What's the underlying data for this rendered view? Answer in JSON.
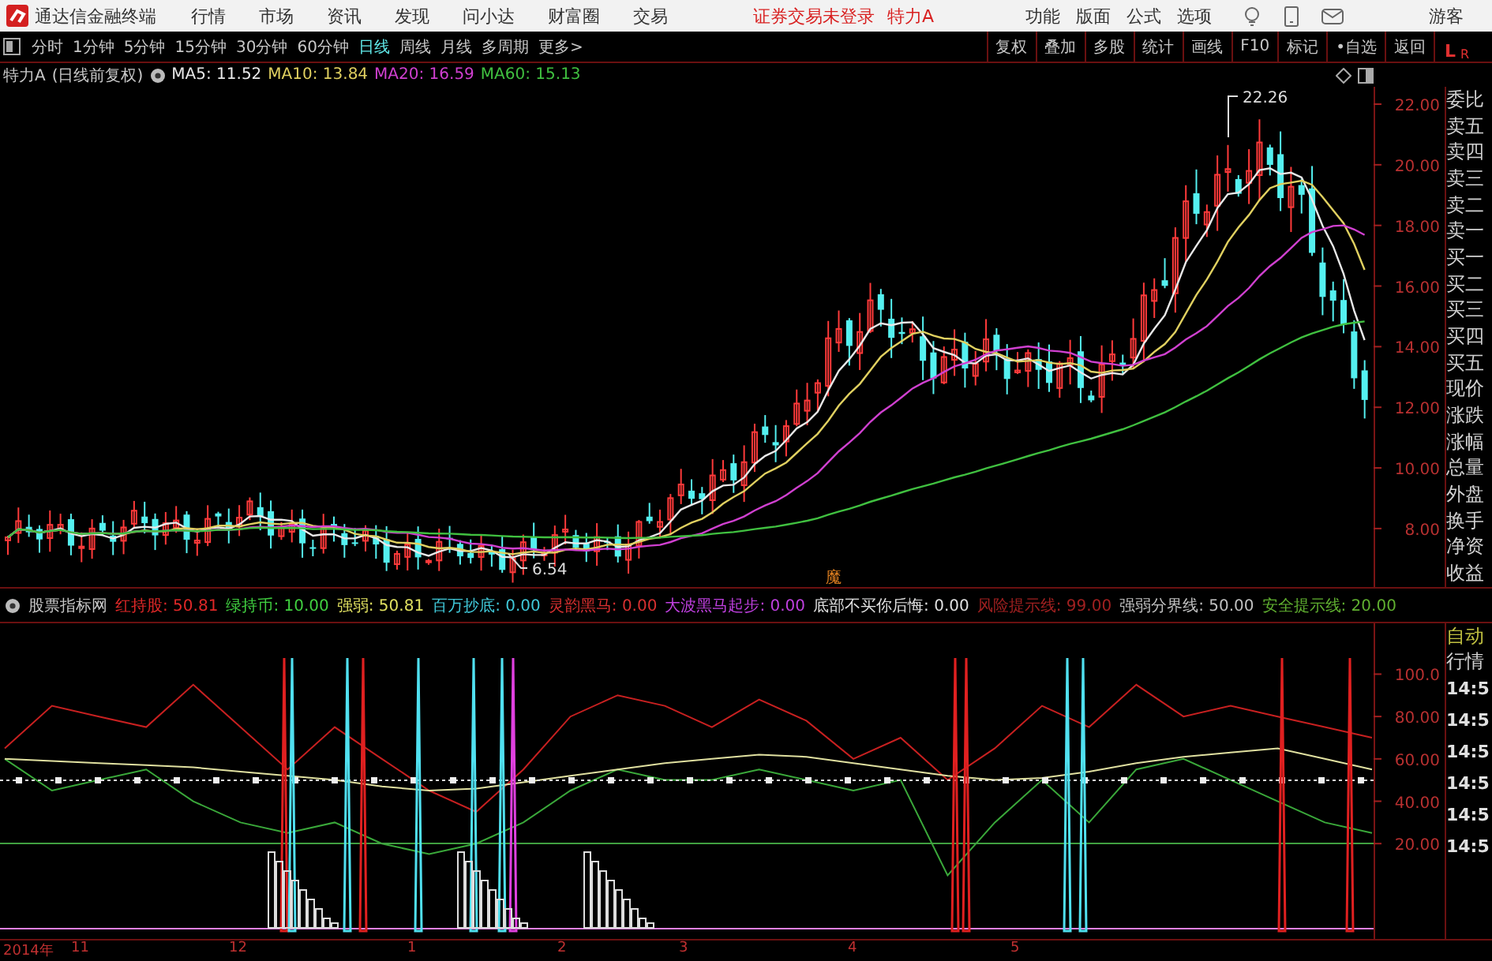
{
  "title_bar": {
    "app_name": "通达信金融终端",
    "menu": [
      "行情",
      "市场",
      "资讯",
      "发现",
      "问小达",
      "财富圈",
      "交易"
    ],
    "login_status": "证券交易未登录",
    "stock_name": "特力A",
    "right_menu": [
      "功能",
      "版面",
      "公式",
      "选项"
    ],
    "user": "游客"
  },
  "period_tabs": [
    {
      "label": "分时",
      "selected": false
    },
    {
      "label": "1分钟",
      "selected": false
    },
    {
      "label": "5分钟",
      "selected": false
    },
    {
      "label": "15分钟",
      "selected": false
    },
    {
      "label": "30分钟",
      "selected": false
    },
    {
      "label": "60分钟",
      "selected": false
    },
    {
      "label": "日线",
      "selected": true
    },
    {
      "label": "周线",
      "selected": false
    },
    {
      "label": "月线",
      "selected": false
    },
    {
      "label": "多周期",
      "selected": false
    },
    {
      "label": "更多>",
      "selected": false
    }
  ],
  "tool_buttons": [
    "复权",
    "叠加",
    "多股",
    "统计",
    "画线",
    "F10",
    "标记",
    "•自选",
    "返回"
  ],
  "corner_labels": [
    "L",
    "R"
  ],
  "price_chart": {
    "stock": "特力A",
    "mode": "(日线前复权)",
    "ma": [
      {
        "label": "MA5: 11.52",
        "color": "#e8e8e8"
      },
      {
        "label": "MA10: 13.84",
        "color": "#e0d060"
      },
      {
        "label": "MA20: 16.59",
        "color": "#d040d0"
      },
      {
        "label": "MA60: 15.13",
        "color": "#40c040"
      }
    ],
    "y_labels": [
      "22.00",
      "20.00",
      "18.00",
      "16.00",
      "14.00",
      "12.00",
      "10.00",
      "8.00"
    ],
    "high_label": "22.26",
    "low_label": "6.54",
    "marker": "魔"
  },
  "quote_fields": [
    "委比",
    "卖五",
    "卖四",
    "卖三",
    "卖二",
    "卖一",
    "买一",
    "买二",
    "买三",
    "买四",
    "买五",
    "现价",
    "涨跌",
    "涨幅",
    "总量",
    "外盘",
    "换手",
    "净资",
    "收益"
  ],
  "indicator": {
    "name": "股票指标网",
    "lines": [
      {
        "label": "红持股: 50.81",
        "color": "#e02828"
      },
      {
        "label": "绿持币: 10.00",
        "color": "#40d040"
      },
      {
        "label": "强弱: 50.81",
        "color": "#e0e060"
      },
      {
        "label": "百万抄底: 0.00",
        "color": "#40c8d8"
      },
      {
        "label": "灵韵黑马: 0.00",
        "color": "#d83030"
      },
      {
        "label": "大波黑马起步: 0.00",
        "color": "#c040e0"
      },
      {
        "label": "底部不买你后悔: 0.00",
        "color": "#e0e0e0"
      },
      {
        "label": "风险提示线: 99.00",
        "color": "#a02020"
      },
      {
        "label": "强弱分界线: 50.00",
        "color": "#c0c0c0"
      },
      {
        "label": "安全提示线: 20.00",
        "color": "#60b030"
      }
    ],
    "chart_data": {
      "type": "line",
      "ylim": [
        -25,
        124
      ],
      "yticks": [
        {
          "value": 100,
          "label": "100.0"
        },
        {
          "value": 80,
          "label": "80.00"
        },
        {
          "value": 60,
          "label": "60.00"
        },
        {
          "value": 40,
          "label": "40.00"
        },
        {
          "value": 20,
          "label": "20.00"
        }
      ],
      "series": [
        {
          "color": "#3aa83a",
          "values": [
            60,
            45,
            50,
            55,
            40,
            30,
            25,
            30,
            20,
            15,
            20,
            30,
            45,
            55,
            50,
            50,
            55,
            50,
            45,
            50,
            5,
            30,
            50,
            30,
            55,
            60,
            50,
            40,
            30,
            25
          ]
        },
        {
          "color": "#c82020",
          "values": [
            65,
            85,
            80,
            75,
            95,
            75,
            55,
            75,
            60,
            45,
            35,
            55,
            80,
            90,
            85,
            75,
            88,
            78,
            60,
            70,
            50,
            65,
            85,
            75,
            95,
            80,
            85,
            80,
            75,
            70
          ]
        },
        {
          "color": "#e0e0a0",
          "values": [
            60,
            59,
            58,
            57,
            56,
            54,
            52,
            50,
            47,
            45,
            46,
            49,
            52,
            55,
            58,
            60,
            62,
            61,
            58,
            55,
            52,
            50,
            51,
            54,
            58,
            61,
            63,
            65,
            60,
            55
          ]
        }
      ]
    }
  },
  "side_modes": [
    "自动",
    "行情"
  ],
  "times": [
    "14:5",
    "14:5",
    "14:5",
    "14:5",
    "14:5",
    "14:5"
  ],
  "date_axis": [
    "2014年",
    "11",
    "12",
    "1",
    "2",
    "3",
    "4",
    "5"
  ]
}
